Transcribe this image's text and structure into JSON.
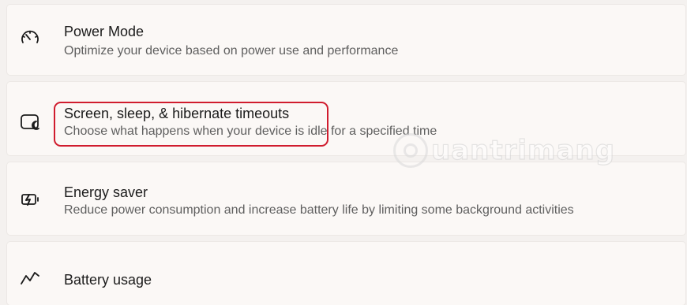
{
  "settings": {
    "items": [
      {
        "icon": "speedometer-icon",
        "title": "Power Mode",
        "description": "Optimize your device based on power use and performance"
      },
      {
        "icon": "screen-sleep-icon",
        "title": "Screen, sleep, & hibernate timeouts",
        "description": "Choose what happens when your device is idle for a specified time"
      },
      {
        "icon": "energy-saver-icon",
        "title": "Energy saver",
        "description": "Reduce power consumption and increase battery life by limiting some background activities"
      },
      {
        "icon": "battery-usage-chart-icon",
        "title": "Battery usage",
        "description": ""
      }
    ]
  },
  "highlight": {
    "color": "#d01c2e"
  },
  "watermark": {
    "text": "uantrimang"
  }
}
